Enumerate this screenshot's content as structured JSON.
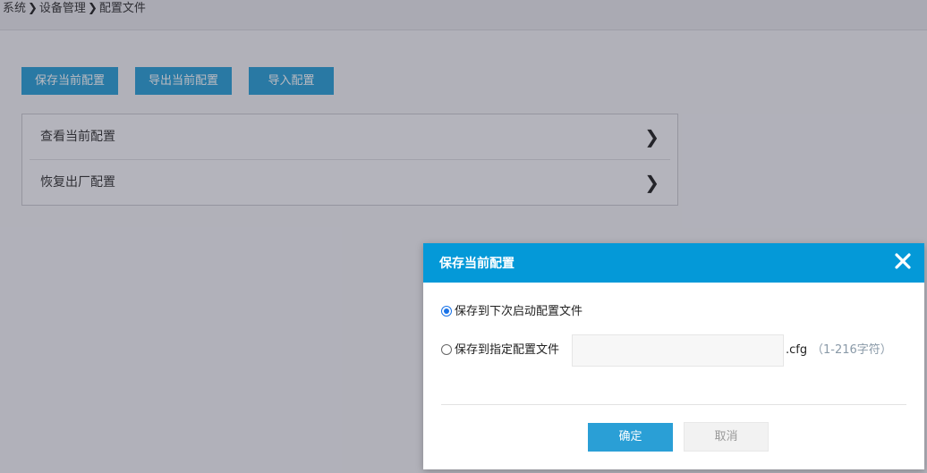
{
  "breadcrumb": {
    "items": [
      "系统",
      "设备管理",
      "配置文件"
    ],
    "separator": "❯"
  },
  "toolbar": {
    "save_label": "保存当前配置",
    "export_label": "导出当前配置",
    "import_label": "导入配置"
  },
  "config_list": {
    "items": [
      {
        "label": "查看当前配置",
        "icon": "chevron-right-icon"
      },
      {
        "label": "恢复出厂配置",
        "icon": "chevron-right-icon"
      }
    ],
    "chevron": "❯"
  },
  "dialog": {
    "title": "保存当前配置",
    "close_icon": "close-icon",
    "options": [
      {
        "label": "保存到下次启动配置文件",
        "selected": true
      },
      {
        "label": "保存到指定配置文件",
        "selected": false
      }
    ],
    "filename": {
      "value": "",
      "placeholder": "",
      "extension": ".cfg",
      "hint": "（1-216字符）"
    },
    "ok_label": "确定",
    "cancel_label": "取消"
  },
  "colors": {
    "primary": "#2a9fd6",
    "dialog_header": "#0499d8"
  }
}
